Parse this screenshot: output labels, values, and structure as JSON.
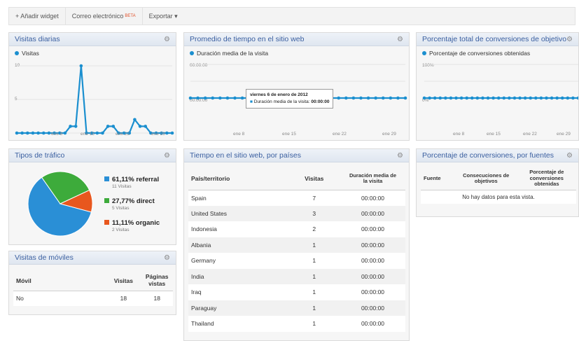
{
  "toolbar": {
    "add_widget": "+ Añadir widget",
    "email": "Correo electrónico",
    "email_badge": "BETA",
    "export": "Exportar ▾"
  },
  "colors": {
    "accent": "#1b8fcf",
    "referral": "#2a8fd6",
    "direct": "#3dab3b",
    "organic": "#e8571e",
    "title": "#3a5fa0"
  },
  "visits_daily": {
    "title": "Visitas diarias",
    "legend": "Visitas",
    "y_ticks": [
      "10",
      "5"
    ],
    "x_ticks": [
      "ene 8",
      "ene 15",
      "ene 22",
      "ene 29"
    ]
  },
  "avg_time": {
    "title": "Promedio de tiempo en el sitio web",
    "legend": "Duración media de la visita",
    "y_ticks": [
      "00:00:00",
      "00:00:00"
    ],
    "x_ticks": [
      "ene 8",
      "ene 15",
      "ene 22",
      "ene 29"
    ],
    "tooltip_date": "viernes 6 de enero de 2012",
    "tooltip_label": "Duración media de la visita:",
    "tooltip_value": "00:00:00"
  },
  "conv_total": {
    "title": "Porcentaje total de conversiones de objetivos",
    "legend": "Porcentaje de conversiones obtenidas",
    "y_ticks": [
      "100%",
      "0%"
    ],
    "x_ticks": [
      "ene 8",
      "ene 15",
      "ene 22",
      "ene 29"
    ]
  },
  "traffic": {
    "title": "Tipos de tráfico",
    "items": [
      {
        "pct": "61,11% referral",
        "sub": "11 Visitas",
        "color": "#2a8fd6"
      },
      {
        "pct": "27,77% direct",
        "sub": "5 Visitas",
        "color": "#3dab3b"
      },
      {
        "pct": "11,11% organic",
        "sub": "2 Visitas",
        "color": "#e8571e"
      }
    ]
  },
  "country": {
    "title": "Tiempo en el sitio web, por países",
    "headers": [
      "País/territorio",
      "Visitas",
      "Duración media de la visita"
    ],
    "rows": [
      [
        "Spain",
        "7",
        "00:00:00"
      ],
      [
        "United States",
        "3",
        "00:00:00"
      ],
      [
        "Indonesia",
        "2",
        "00:00:00"
      ],
      [
        "Albania",
        "1",
        "00:00:00"
      ],
      [
        "Germany",
        "1",
        "00:00:00"
      ],
      [
        "India",
        "1",
        "00:00:00"
      ],
      [
        "Iraq",
        "1",
        "00:00:00"
      ],
      [
        "Paraguay",
        "1",
        "00:00:00"
      ],
      [
        "Thailand",
        "1",
        "00:00:00"
      ]
    ]
  },
  "conv_sources": {
    "title": "Porcentaje de conversiones, por fuentes",
    "headers": [
      "Fuente",
      "Consecuciones de objetivos",
      "Porcentaje de conversiones obtenidas"
    ],
    "empty": "No hay datos para esta vista."
  },
  "mobile": {
    "title": "Visitas de móviles",
    "headers": [
      "Móvil",
      "Visitas",
      "Páginas vistas"
    ],
    "rows": [
      [
        "No",
        "18",
        "18"
      ]
    ]
  },
  "chart_data": [
    {
      "type": "line",
      "title": "Visitas diarias",
      "series": [
        {
          "name": "Visitas",
          "values": [
            0,
            0,
            0,
            0,
            0,
            0,
            0,
            0,
            0,
            0,
            1,
            1,
            10,
            0,
            0,
            0,
            0,
            1,
            1,
            0,
            0,
            0,
            2,
            1,
            1,
            0,
            0,
            0,
            0,
            0
          ]
        }
      ],
      "y_ticks": [
        "10",
        "5"
      ],
      "x_ticks": [
        "ene 8",
        "ene 15",
        "ene 22",
        "ene 29"
      ],
      "ylim": [
        0,
        10
      ]
    },
    {
      "type": "line",
      "title": "Promedio de tiempo en el sitio web",
      "series": [
        {
          "name": "Duración media de la visita",
          "values": [
            0,
            0,
            0,
            0,
            0,
            0,
            0,
            0,
            0,
            0,
            0,
            0,
            0,
            0,
            0,
            0,
            0,
            0,
            0,
            0,
            0,
            0,
            0,
            0,
            0,
            0,
            0,
            0,
            0,
            0
          ]
        }
      ],
      "y_ticks": [
        "00:00:00",
        "00:00:00"
      ],
      "x_ticks": [
        "ene 8",
        "ene 15",
        "ene 22",
        "ene 29"
      ]
    },
    {
      "type": "line",
      "title": "Porcentaje total de conversiones de objetivos",
      "series": [
        {
          "name": "Porcentaje de conversiones obtenidas",
          "values": [
            0,
            0,
            0,
            0,
            0,
            0,
            0,
            0,
            0,
            0,
            0,
            0,
            0,
            0,
            0,
            0,
            0,
            0,
            0,
            0,
            0,
            0,
            0,
            0,
            0,
            0,
            0,
            0,
            0,
            0
          ]
        }
      ],
      "y_ticks": [
        "100%",
        "0%"
      ],
      "x_ticks": [
        "ene 8",
        "ene 15",
        "ene 22",
        "ene 29"
      ],
      "ylim": [
        0,
        100
      ]
    },
    {
      "type": "pie",
      "title": "Tipos de tráfico",
      "categories": [
        "referral",
        "direct",
        "organic"
      ],
      "values": [
        61.11,
        27.77,
        11.11
      ]
    }
  ]
}
